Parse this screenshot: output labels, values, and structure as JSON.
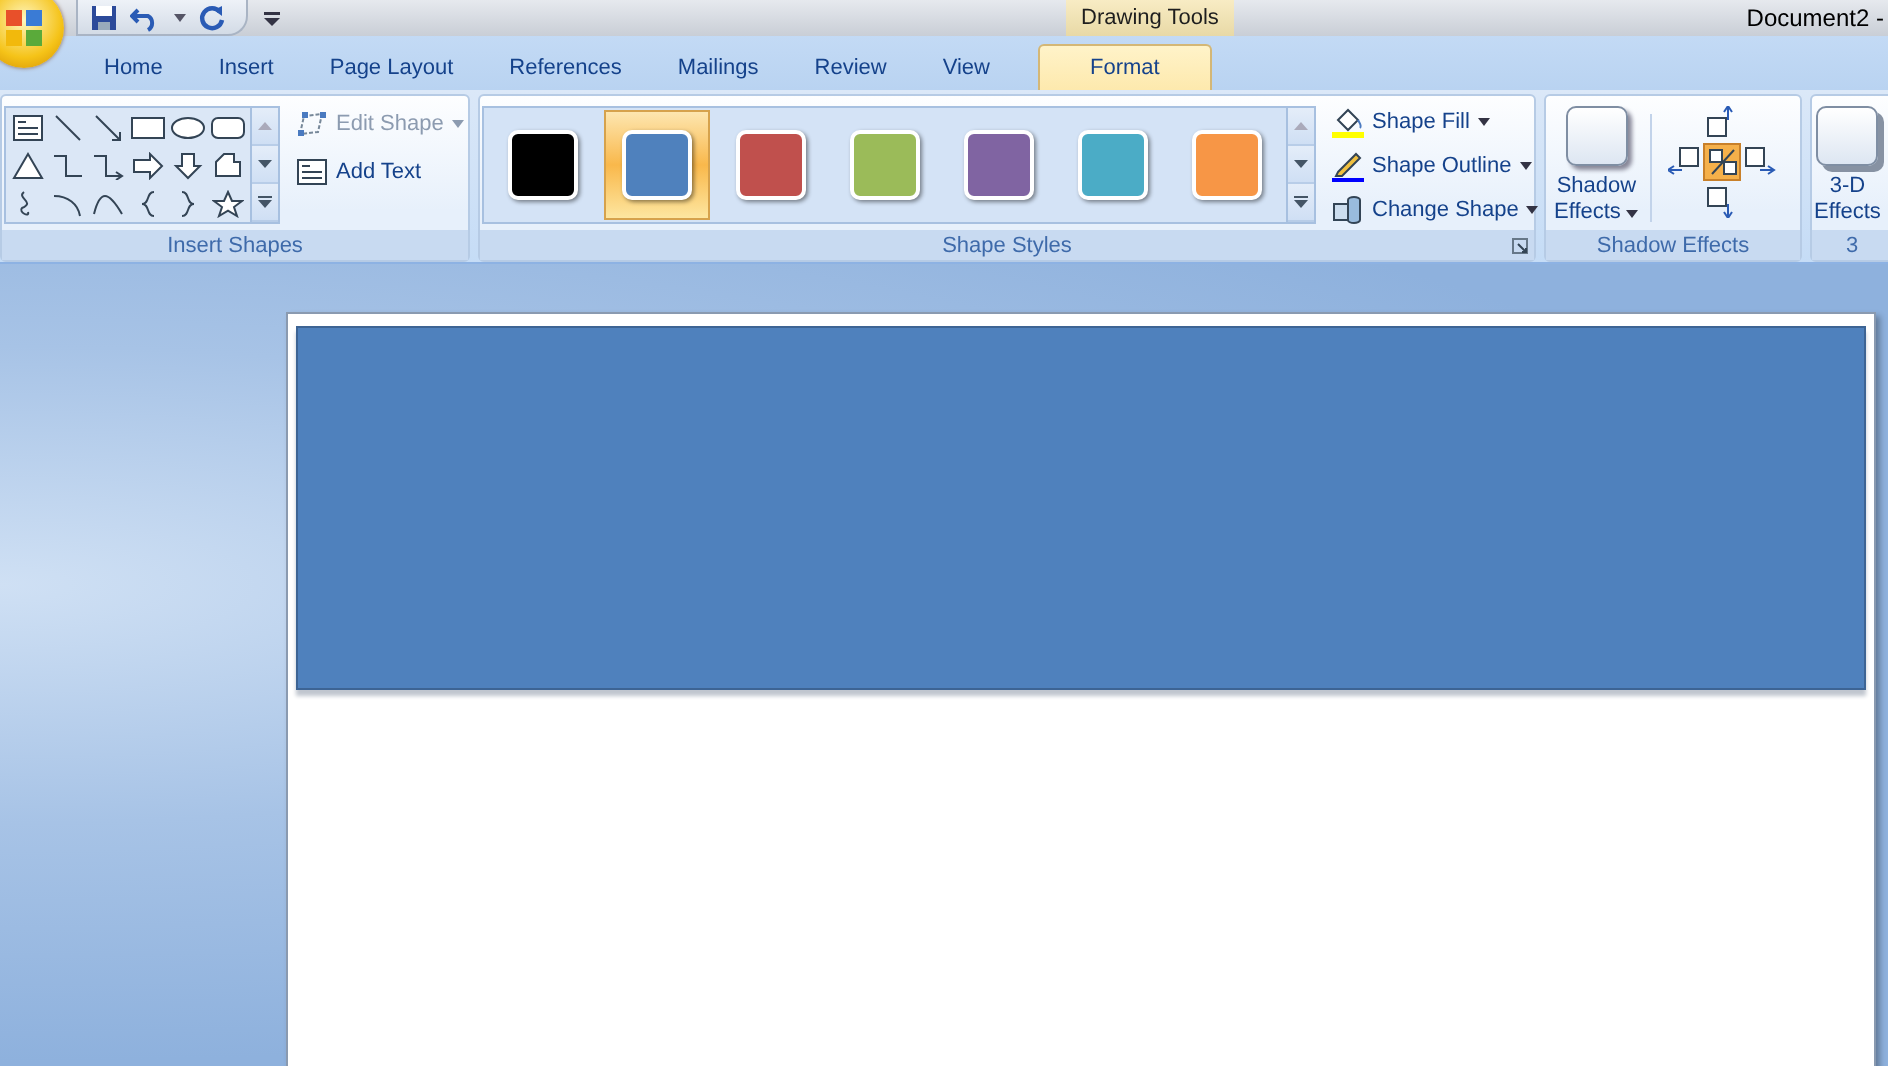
{
  "title_bar": {
    "contextual_label": "Drawing Tools",
    "document_title": "Document2 -"
  },
  "tabs": [
    {
      "label": "Home",
      "selected": false
    },
    {
      "label": "Insert",
      "selected": false
    },
    {
      "label": "Page Layout",
      "selected": false
    },
    {
      "label": "References",
      "selected": false
    },
    {
      "label": "Mailings",
      "selected": false
    },
    {
      "label": "Review",
      "selected": false
    },
    {
      "label": "View",
      "selected": false
    },
    {
      "label": "Format",
      "selected": true
    }
  ],
  "insert_shapes": {
    "label": "Insert Shapes",
    "edit_shape": {
      "label": "Edit Shape",
      "disabled": true
    },
    "add_text": {
      "label": "Add Text",
      "disabled": false
    }
  },
  "shape_styles": {
    "label": "Shape Styles",
    "styles": [
      {
        "color": "#000000",
        "selected": false
      },
      {
        "color": "#4f81bd",
        "selected": true
      },
      {
        "color": "#c0504d",
        "selected": false
      },
      {
        "color": "#9bbb59",
        "selected": false
      },
      {
        "color": "#8064a2",
        "selected": false
      },
      {
        "color": "#4bacc6",
        "selected": false
      },
      {
        "color": "#f79646",
        "selected": false
      }
    ],
    "commands": [
      "Shape Fill",
      "Shape Outline",
      "Change Shape"
    ]
  },
  "shadow_effects": {
    "label": "Shadow Effects",
    "button": [
      "Shadow",
      "Effects"
    ]
  },
  "three_d": {
    "button": [
      "3-D",
      "Effects"
    ],
    "label": "3"
  }
}
